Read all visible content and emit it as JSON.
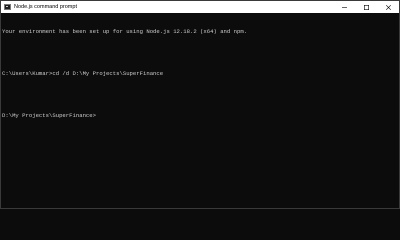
{
  "window": {
    "title": "Node.js command prompt",
    "icon": "console-icon"
  },
  "controls": {
    "minimize": "minimize-icon",
    "maximize": "maximize-icon",
    "close": "close-icon"
  },
  "console": {
    "lines": [
      "Your environment has been set up for using Node.js 12.18.2 (x64) and npm.",
      "",
      "C:\\Users\\Kumar>cd /d D:\\My Projects\\SuperFinance",
      "",
      "D:\\My Projects\\SuperFinance>"
    ]
  },
  "colors": {
    "background": "#0c0c0c",
    "text": "#cccccc",
    "titlebar": "#ffffff"
  }
}
